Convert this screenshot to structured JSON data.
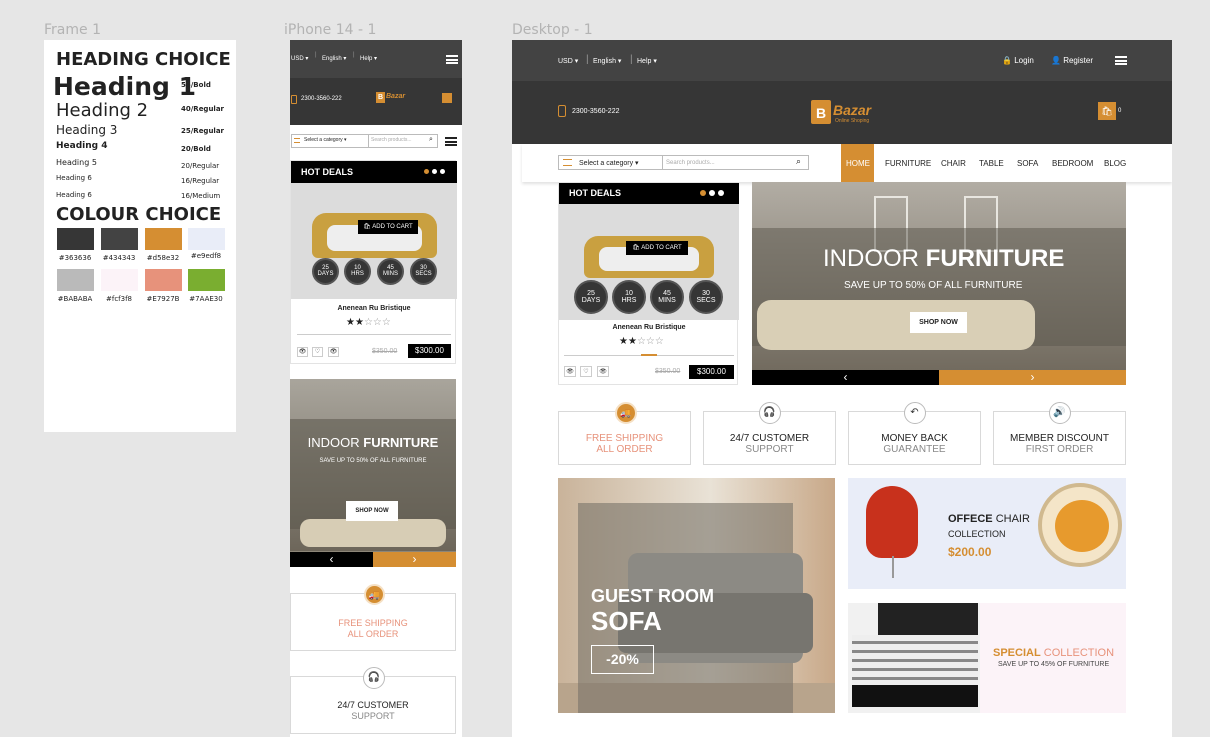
{
  "labels": {
    "frame1": "Frame 1",
    "iphone": "iPhone 14 - 1",
    "desktop": "Desktop - 1"
  },
  "style_guide": {
    "heading_choice": "HEADING CHOICE",
    "headings": [
      {
        "text": "Heading 1",
        "note": "55/Bold"
      },
      {
        "text": "Heading 2",
        "note": "40/Regular"
      },
      {
        "text": "Heading 3",
        "note": "25/Regular"
      },
      {
        "text": "Heading 4",
        "note": "20/Bold"
      },
      {
        "text": "Heading 5",
        "note": "20/Regular"
      },
      {
        "text": "Heading 6",
        "note": "16/Regular"
      },
      {
        "text": "Heading 6",
        "note": "16/Medium"
      }
    ],
    "colour_choice": "COLOUR CHOICE",
    "colours": [
      {
        "hex": "#363636",
        "label": "#363636"
      },
      {
        "hex": "#434343",
        "label": "#434343"
      },
      {
        "hex": "#d58e32",
        "label": "#d58e32"
      },
      {
        "hex": "#e9edf8",
        "label": "#e9edf8"
      },
      {
        "hex": "#BABABA",
        "label": "#BABABA"
      },
      {
        "hex": "#fcf3f8",
        "label": "#fcf3f8"
      },
      {
        "hex": "#E7927B",
        "label": "#E7927B"
      },
      {
        "hex": "#7AAE30",
        "label": "#7AAE30"
      }
    ]
  },
  "topbar": {
    "currency": "USD",
    "language": "English",
    "help": "Help",
    "login": "Login",
    "register": "Register"
  },
  "header": {
    "phone": "2300-3560-222",
    "brand": "Bazar",
    "tagline": "Online Shoping",
    "cart_count": "0"
  },
  "search": {
    "category": "Select a category",
    "placeholder": "Search products..."
  },
  "nav": [
    "HOME",
    "FURNITURE",
    "CHAIR",
    "TABLE",
    "SOFA",
    "BEDROOM",
    "BLOG"
  ],
  "hot_deals": {
    "title": "HOT DEALS",
    "add_to_cart": "ADD TO CART",
    "timers": [
      {
        "value": "25",
        "unit": "DAYS"
      },
      {
        "value": "10",
        "unit": "HRS"
      },
      {
        "value": "45",
        "unit": "MINS"
      },
      {
        "value": "30",
        "unit": "SECS"
      }
    ],
    "product": "Anenean Ru Bristique",
    "rating": 2,
    "stars_filled": "★★",
    "stars_empty": "☆☆☆",
    "old_price": "$350.00",
    "price": "$300.00"
  },
  "banner": {
    "title_light": "INDOOR",
    "title_bold": "FURNITURE",
    "subtitle": "SAVE UP TO 50% OF ALL FURNITURE",
    "button": "SHOP NOW",
    "prev": "‹",
    "next": "›"
  },
  "services": [
    {
      "title": "FREE SHIPPING",
      "sub": "ALL ORDER",
      "icon": "truck-icon"
    },
    {
      "title": "24/7 CUSTOMER",
      "sub": "SUPPORT",
      "icon": "headset-icon"
    },
    {
      "title": "MONEY BACK",
      "sub": "GUARANTEE",
      "icon": "return-icon"
    },
    {
      "title": "MEMBER DISCOUNT",
      "sub": "FIRST ORDER",
      "icon": "speaker-icon"
    }
  ],
  "promo_sofa": {
    "line1": "GUEST ROOM",
    "line2": "SOFA",
    "badge": "-20%"
  },
  "promo_chair": {
    "bold": "OFFECE",
    "light": "CHAIR",
    "sub": "COLLECTION",
    "price": "$200.00"
  },
  "promo_bed": {
    "bold": "SPECIAL",
    "light": "COLLECTION",
    "sub": "SAVE UP TO 45% OF FURNITURE"
  },
  "colors": {
    "accent": "#d58e32",
    "dark": "#363636",
    "topbar": "#434343",
    "salmon": "#E7927B"
  }
}
